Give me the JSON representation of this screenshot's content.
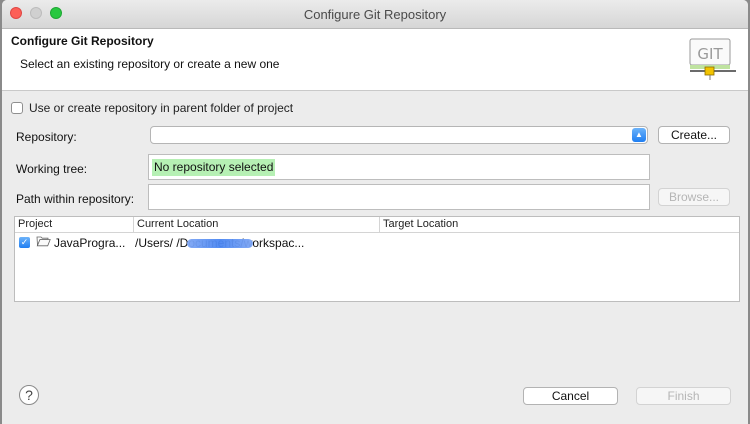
{
  "window": {
    "title": "Configure Git Repository"
  },
  "header": {
    "title": "Configure Git Repository",
    "subtitle": "Select an existing repository or create a new one",
    "icon_text": "GIT"
  },
  "form": {
    "parent_checkbox_label": "Use or create repository in parent folder of project",
    "parent_checked": false,
    "repository_label": "Repository:",
    "repository_value": "",
    "create_label": "Create...",
    "working_tree_label": "Working tree:",
    "working_tree_value": "No repository selected",
    "path_label": "Path within repository:",
    "path_value": "",
    "browse_label": "Browse..."
  },
  "table": {
    "columns": [
      "Project",
      "Current Location",
      "Target Location"
    ],
    "rows": [
      {
        "checked": true,
        "project": "JavaProgra...",
        "current_location": "/Users/                    /Documents/workspac...",
        "target_location": ""
      }
    ]
  },
  "footer": {
    "help_glyph": "?",
    "cancel_label": "Cancel",
    "finish_label": "Finish"
  },
  "colors": {
    "highlight": "#b6f0b4",
    "accent": "#1f7ef2",
    "redaction": "#4a86f2"
  }
}
